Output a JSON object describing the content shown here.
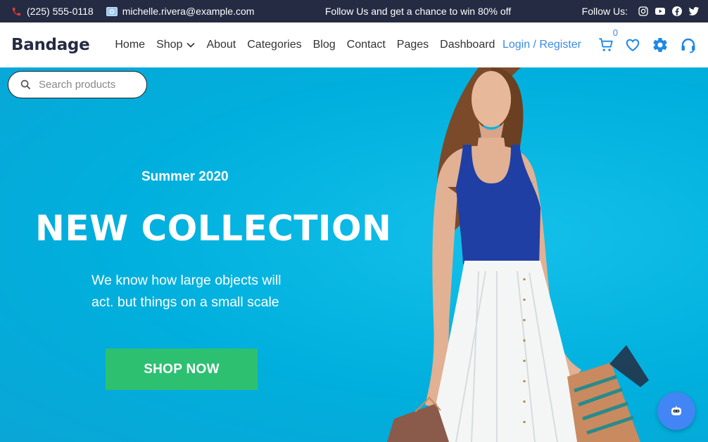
{
  "topbar": {
    "phone": "(225) 555-0118",
    "email": "michelle.rivera@example.com",
    "promo": "Follow Us and get a chance to win 80% off",
    "follow_label": "Follow Us:",
    "social_icons": [
      "instagram-icon",
      "youtube-icon",
      "facebook-icon",
      "twitter-icon"
    ]
  },
  "navbar": {
    "brand": "Bandage",
    "menu": [
      "Home",
      "Shop",
      "About",
      "Categories",
      "Blog",
      "Contact",
      "Pages",
      "Dashboard"
    ],
    "login_label": "Login / Register",
    "cart_count": "0",
    "icons": [
      "cart-icon",
      "heart-icon",
      "gear-icon",
      "headset-icon"
    ]
  },
  "search": {
    "placeholder": "Search products",
    "value": ""
  },
  "hero": {
    "subtitle": "Summer 2020",
    "title": "NEW COLLECTION",
    "description": "We know how large objects will act. but things on a small scale",
    "cta_label": "SHOP NOW"
  },
  "colors": {
    "topbar_bg": "#252b42",
    "hero_bg": "#00b3df",
    "accent_blue": "#1e88e5",
    "cta_green": "#2dc071",
    "chat_fab": "#4285f4"
  }
}
